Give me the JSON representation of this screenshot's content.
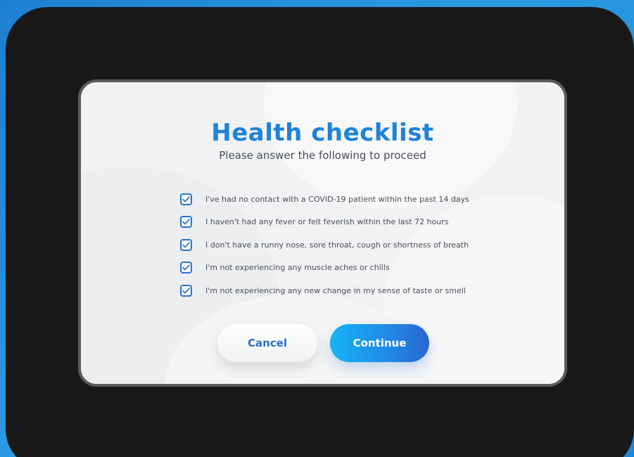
{
  "dialog": {
    "title": "Health checklist",
    "subtitle": "Please answer the following to proceed",
    "items": [
      {
        "label": "I've had no contact with a COVID-19 patient within the past 14 days",
        "checked": true
      },
      {
        "label": "I haven't had any fever or felt feverish within the last 72 hours",
        "checked": true
      },
      {
        "label": "I don't have a runny nose, sore throat, cough or shortness of breath",
        "checked": true
      },
      {
        "label": "I'm not experiencing any muscle aches or chills",
        "checked": true
      },
      {
        "label": "I'm not experiencing any new change in my sense of taste or smell",
        "checked": true
      }
    ],
    "cancel_label": "Cancel",
    "continue_label": "Continue"
  },
  "colors": {
    "accent": "#1f83d8",
    "checkbox": "#2a74cf",
    "continue_start": "#17b2f5",
    "continue_end": "#2a66cf",
    "background": "#1f86d6",
    "frame": "#181818"
  },
  "icons": {
    "checkbox": "check-icon"
  }
}
